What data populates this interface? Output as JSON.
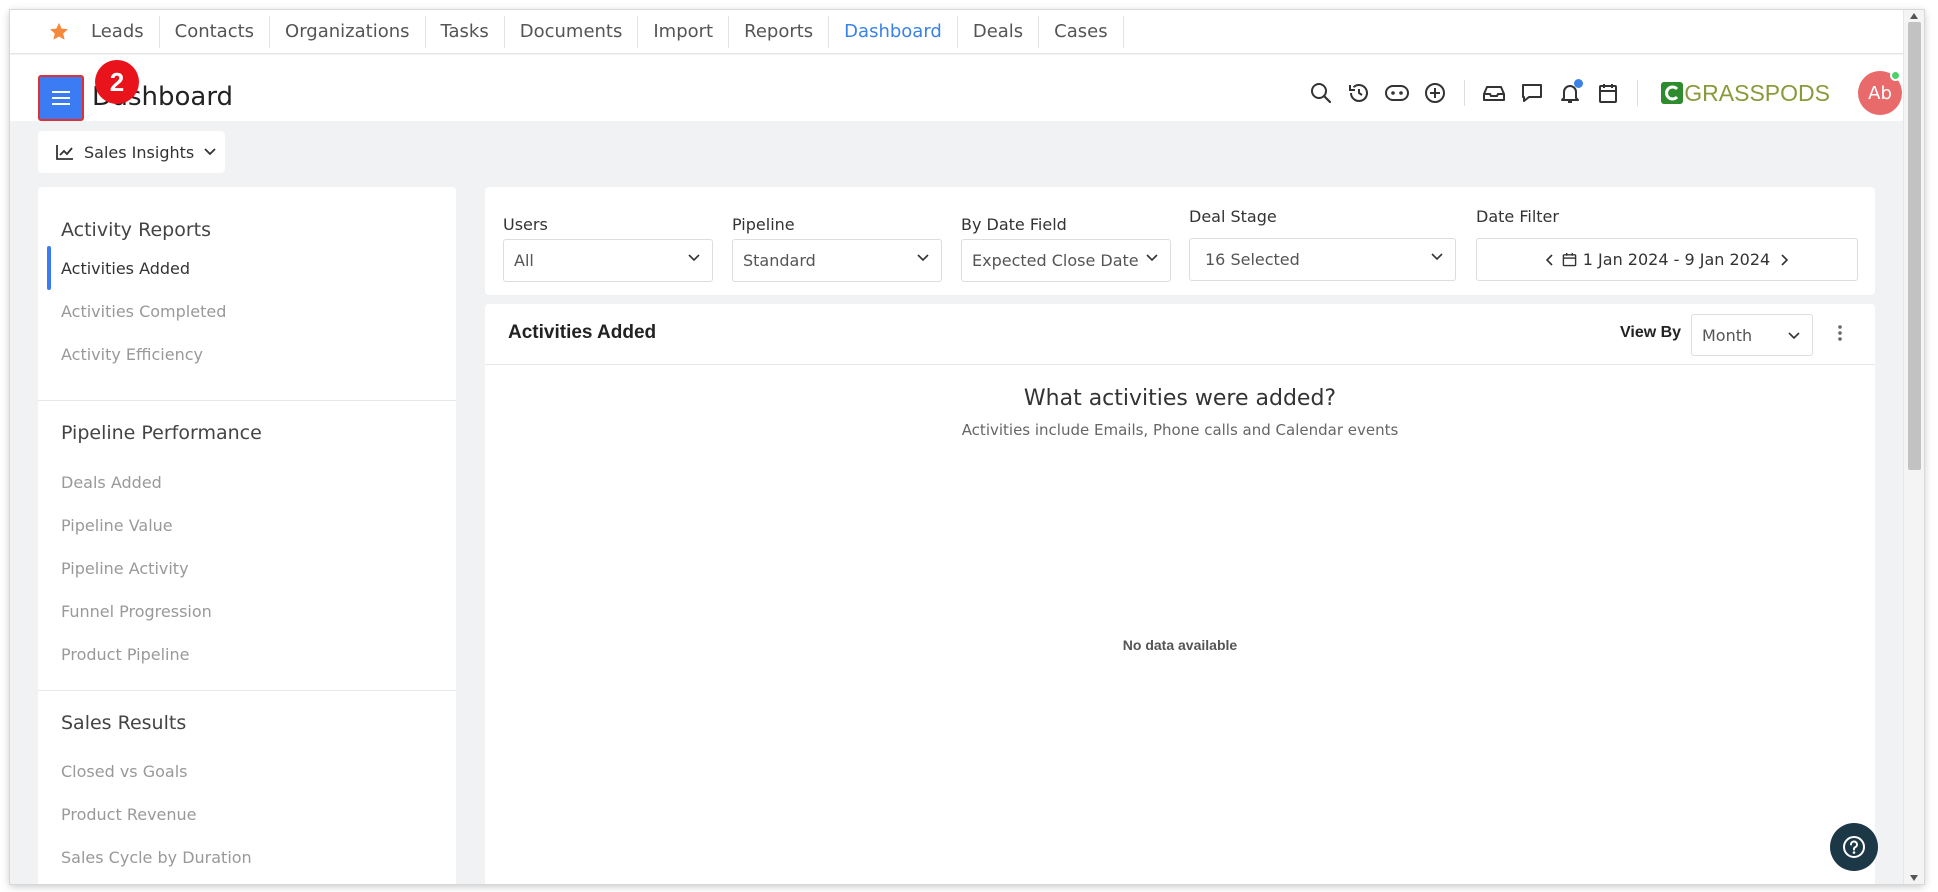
{
  "topnav": {
    "items": [
      "Leads",
      "Contacts",
      "Organizations",
      "Tasks",
      "Documents",
      "Import",
      "Reports",
      "Dashboard",
      "Deals",
      "Cases"
    ],
    "active": "Dashboard",
    "star_icon": "star-icon"
  },
  "header": {
    "title": "Dashboard",
    "step_badge": "2",
    "logo_text": "GRASSPODS",
    "avatar_initials": "Ab",
    "icons": [
      "search-icon",
      "history-icon",
      "bot-icon",
      "plus-circle-icon",
      "inbox-icon",
      "chat-icon",
      "bell-icon",
      "calendar-icon"
    ]
  },
  "insights": {
    "label": "Sales Insights"
  },
  "sidebar": {
    "sections": [
      {
        "title": "Activity Reports",
        "items": [
          "Activities Added",
          "Activities Completed",
          "Activity Efficiency"
        ]
      },
      {
        "title": "Pipeline Performance",
        "items": [
          "Deals Added",
          "Pipeline Value",
          "Pipeline Activity",
          "Funnel Progression",
          "Product Pipeline"
        ]
      },
      {
        "title": "Sales Results",
        "items": [
          "Closed vs Goals",
          "Product Revenue",
          "Sales Cycle by Duration"
        ]
      }
    ],
    "active_item": "Activities Added"
  },
  "filters": {
    "users": {
      "label": "Users",
      "value": "All"
    },
    "pipeline": {
      "label": "Pipeline",
      "value": "Standard"
    },
    "date_field": {
      "label": "By Date Field",
      "value": "Expected Close Date"
    },
    "deal_stage": {
      "label": "Deal Stage",
      "value": "16 Selected"
    },
    "date_filter": {
      "label": "Date Filter",
      "value": "1 Jan 2024 - 9 Jan 2024"
    }
  },
  "card": {
    "title": "Activities Added",
    "view_by_label": "View By",
    "view_by_value": "Month",
    "heading": "What activities were added?",
    "subheading": "Activities include Emails, Phone calls and Calendar events",
    "empty_text": "No data available"
  },
  "colors": {
    "accent": "#3b7cf5",
    "active_nav": "#3b82e6",
    "badge": "#e8131b",
    "avatar": "#e86a6a",
    "star": "#f5883a"
  }
}
